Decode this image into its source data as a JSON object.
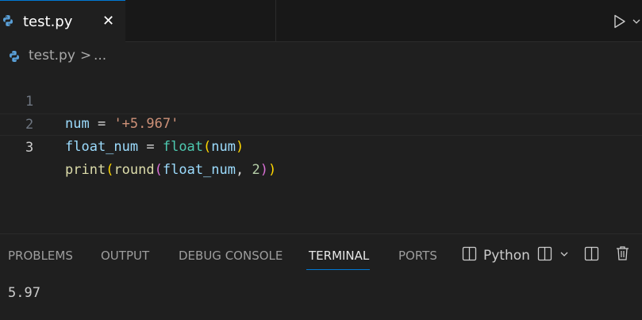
{
  "editor_tab": {
    "filename": "test.py",
    "close_glyph": "✕",
    "icon": "python-icon"
  },
  "toolbar": {
    "run_icon": "run-icon",
    "run_menu_icon": "chevron-down-icon"
  },
  "breadcrumb": {
    "file": "test.py",
    "separator": ">",
    "more": "..."
  },
  "code_lines": [
    {
      "number": "1",
      "tokens": [
        "num",
        " = ",
        "'+5.967'"
      ]
    },
    {
      "number": "2",
      "tokens": [
        "float_num",
        " = ",
        "float",
        "(",
        "num",
        ")"
      ]
    },
    {
      "number": "3",
      "tokens": [
        "print",
        "(",
        "round",
        "(",
        "float_num",
        ", ",
        "2",
        ")",
        ")"
      ]
    }
  ],
  "panel": {
    "tabs": [
      "PROBLEMS",
      "OUTPUT",
      "DEBUG CONSOLE",
      "TERMINAL",
      "PORTS"
    ],
    "active_tab": "TERMINAL",
    "terminal_name": "Python",
    "terminal_output": "5.97"
  },
  "colors": {
    "background": "#1f1f1f",
    "accent": "#0078d4",
    "variable": "#9cdcfe",
    "string": "#ce9178",
    "function": "#dcdcaa",
    "builtin": "#4ec9b0",
    "number": "#b5cea8",
    "bracket_level_1": "#ffd700",
    "bracket_level_2": "#da70d6",
    "bracket_level_3": "#179fff"
  }
}
